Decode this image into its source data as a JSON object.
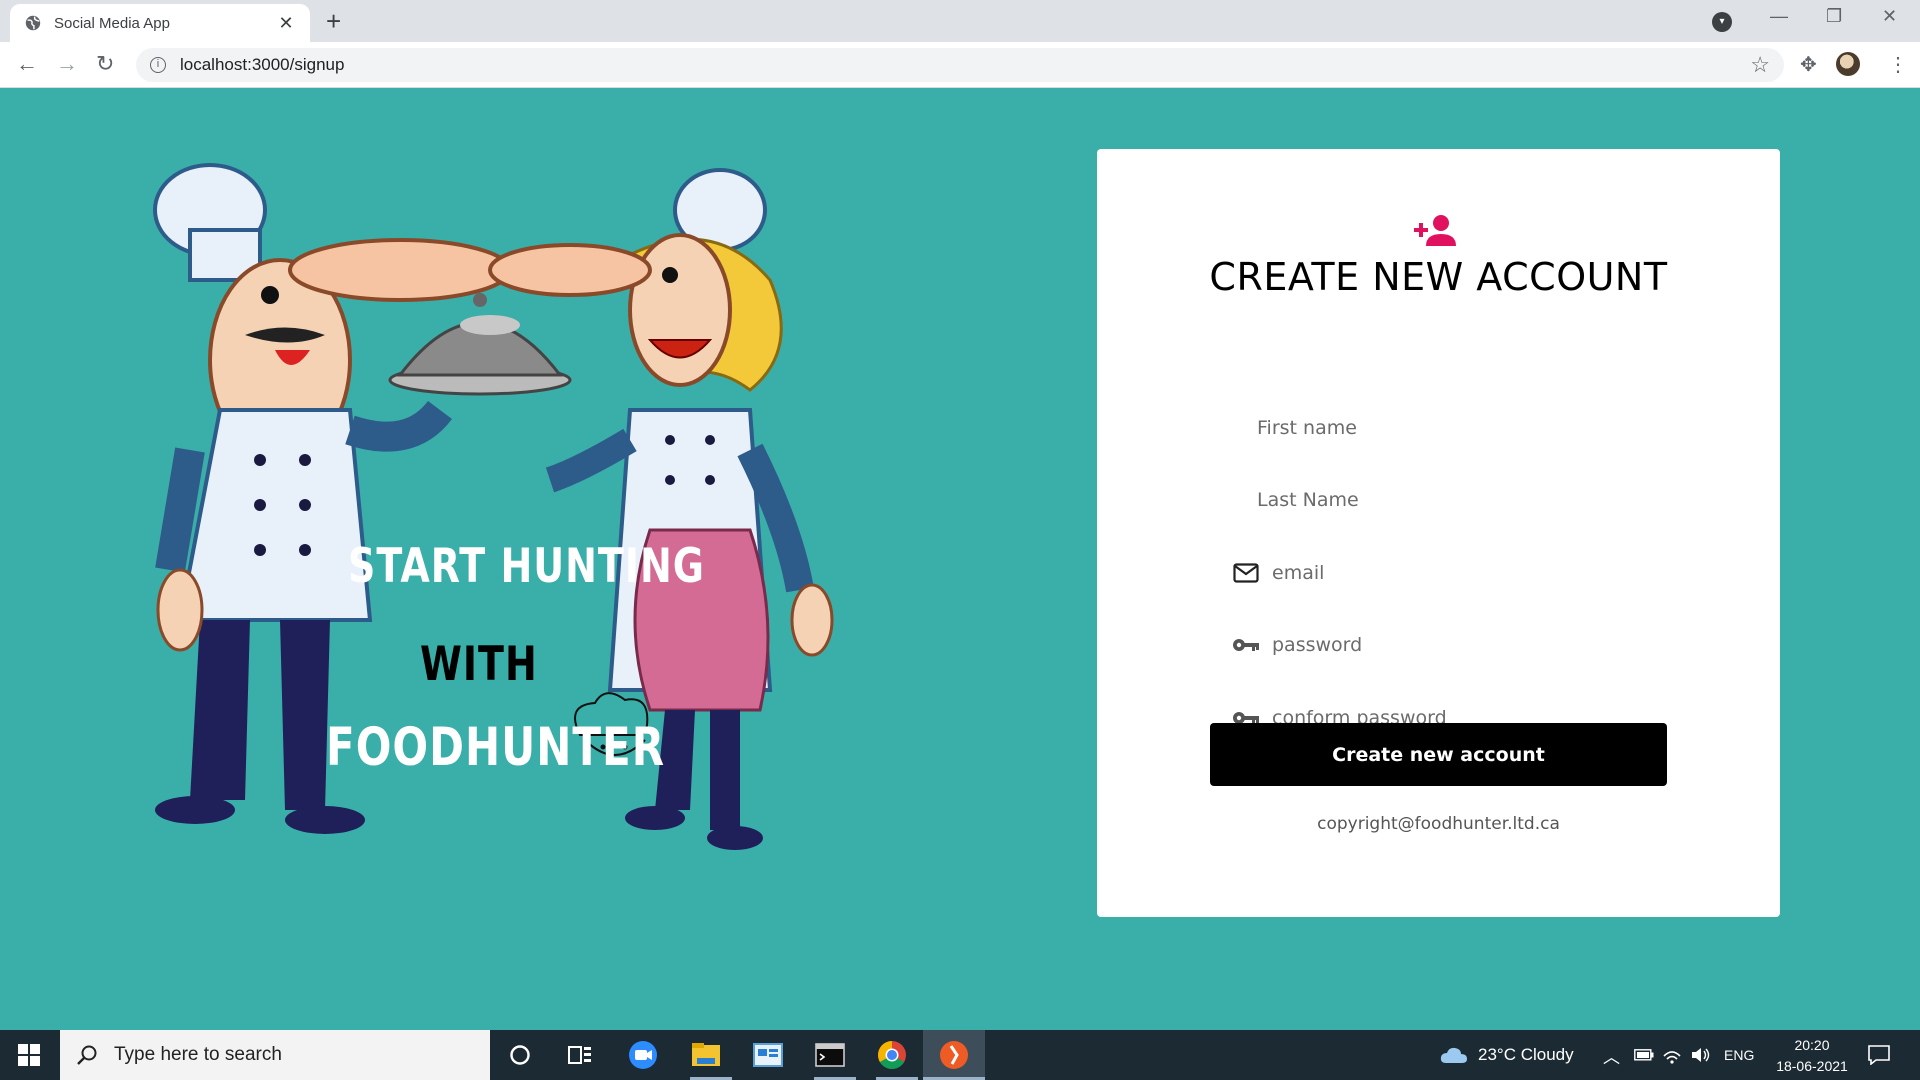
{
  "browser": {
    "tab_title": "Social Media App",
    "url": "localhost:3000/signup"
  },
  "promo": {
    "line1": "START HUNTING",
    "line2": "WITH",
    "line3": "FOODHUNTER"
  },
  "form": {
    "heading": "CREATE NEW ACCOUNT",
    "first_name_placeholder": "First name",
    "last_name_placeholder": "Last Name",
    "email_placeholder": "email",
    "password_placeholder": "password",
    "confirm_password_placeholder": "conform password",
    "submit_label": "Create new account",
    "copyright": "copyright@foodhunter.ltd.ca",
    "accent_color": "#e0115f"
  },
  "taskbar": {
    "search_placeholder": "Type here to search",
    "weather": "23°C  Cloudy",
    "language": "ENG",
    "time": "20:20",
    "date": "18-06-2021"
  },
  "colors": {
    "page_background": "#3aaea9",
    "card_background": "#ffffff",
    "button_background": "#000000"
  }
}
